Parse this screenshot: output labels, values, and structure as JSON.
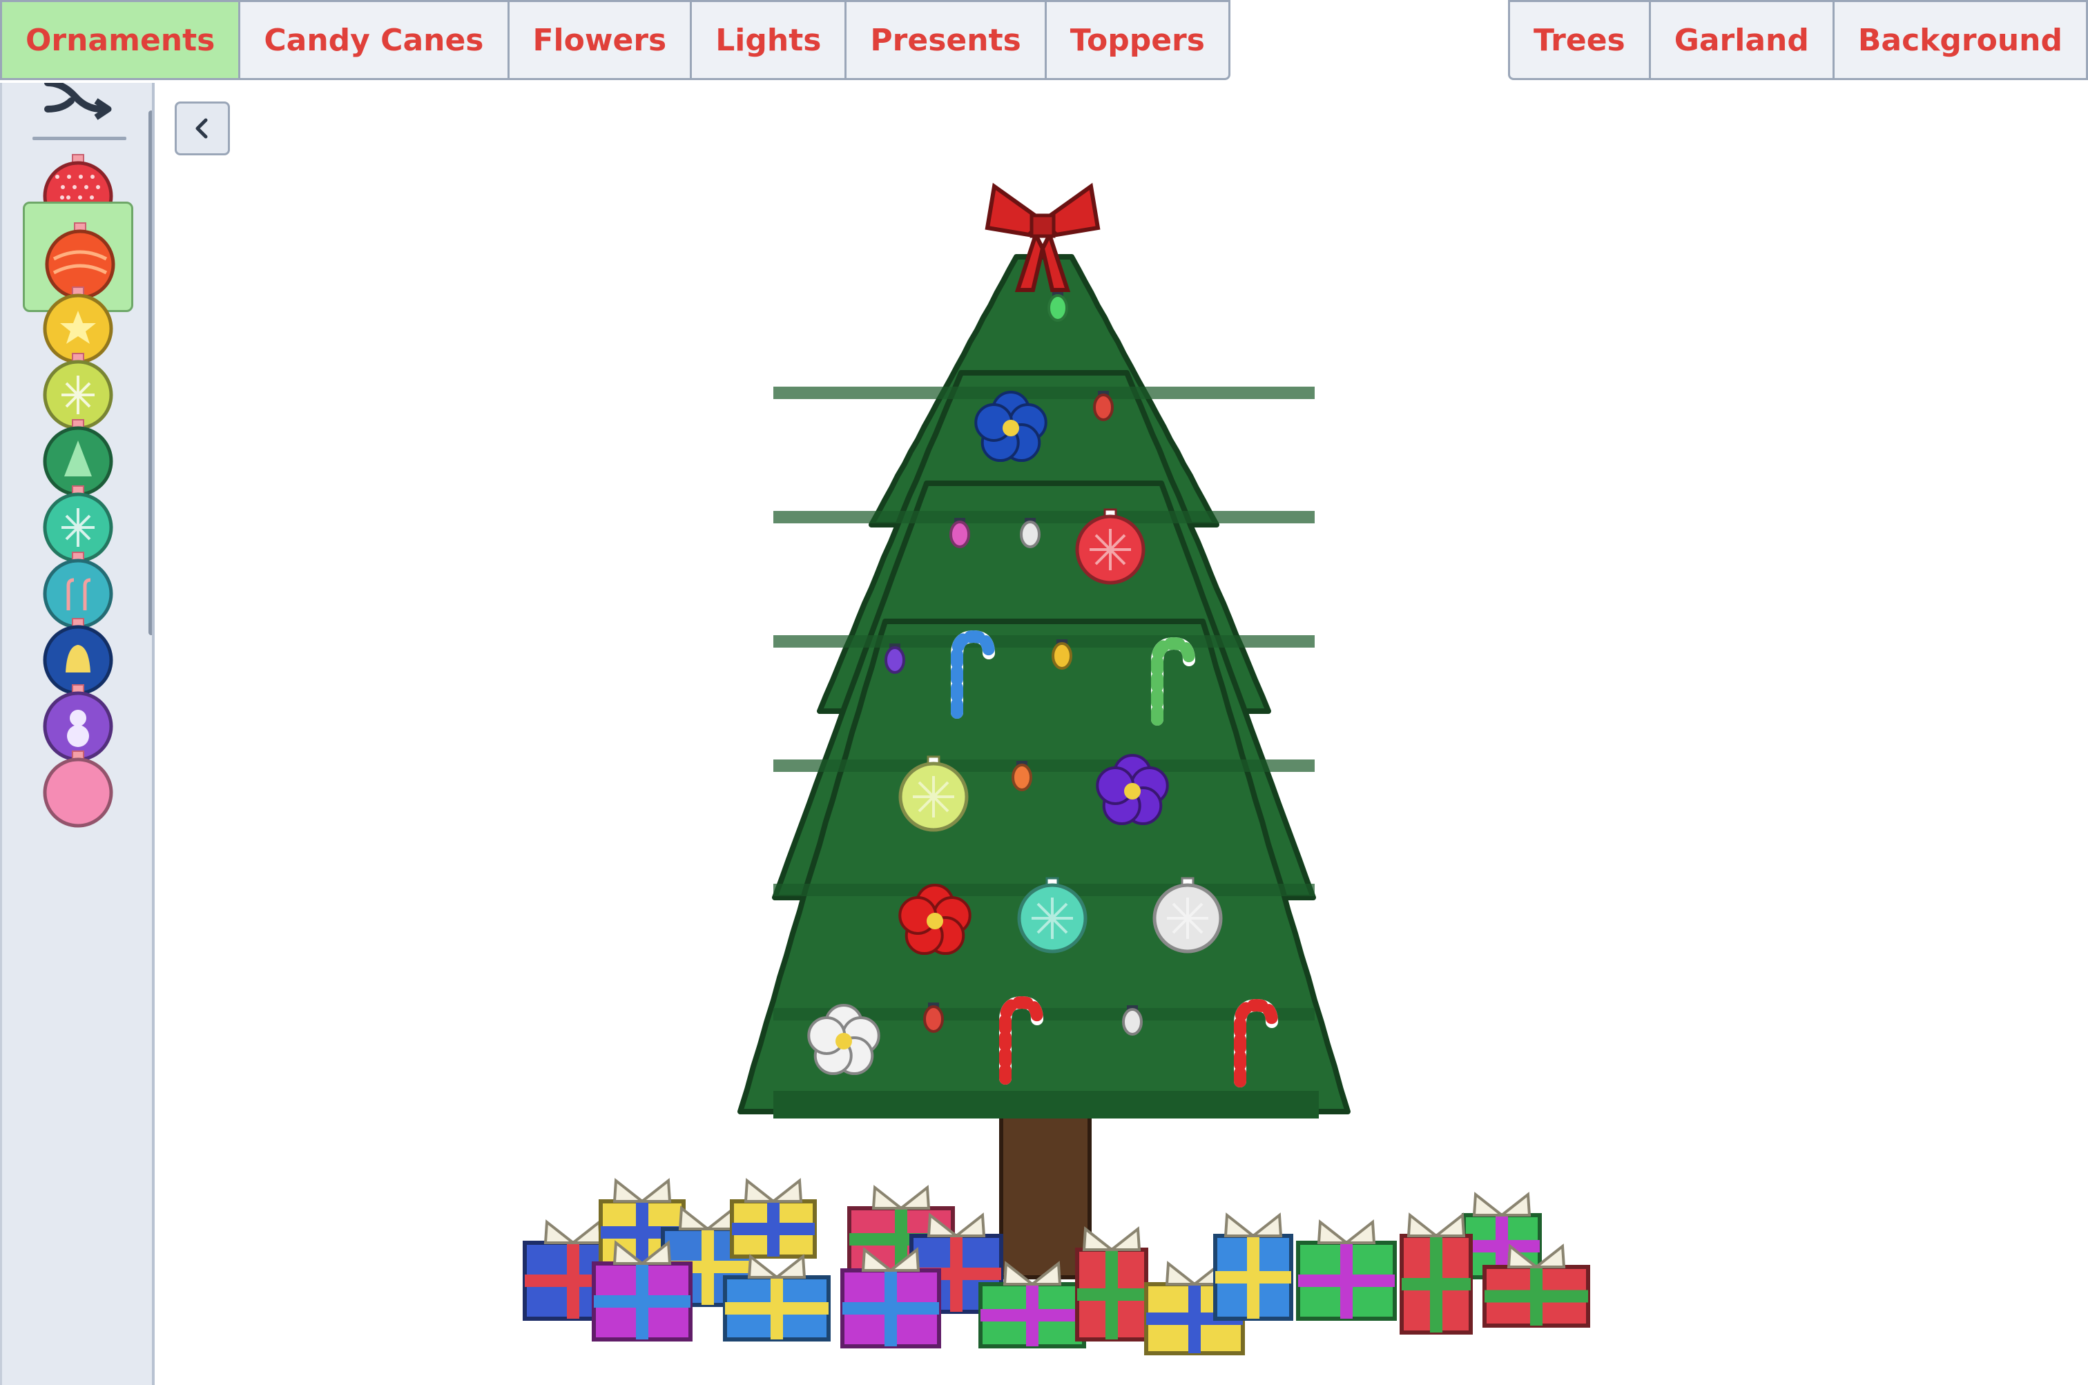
{
  "tabs_left": [
    {
      "label": "Ornaments",
      "active": true
    },
    {
      "label": "Candy Canes",
      "active": false
    },
    {
      "label": "Flowers",
      "active": false
    },
    {
      "label": "Lights",
      "active": false
    },
    {
      "label": "Presents",
      "active": false
    },
    {
      "label": "Toppers",
      "active": false
    }
  ],
  "tabs_right": [
    {
      "label": "Trees"
    },
    {
      "label": "Garland"
    },
    {
      "label": "Background"
    }
  ],
  "sidebar": {
    "top_icon": "shuffle-icon",
    "items": [
      {
        "name": "red-dotted-ornament",
        "color": "#e83a44",
        "pattern": "dots",
        "selected": false
      },
      {
        "name": "orange-swirl-ornament",
        "color": "#f2552a",
        "pattern": "swirl",
        "selected": true
      },
      {
        "name": "yellow-star-ornament",
        "color": "#f3c631",
        "pattern": "star",
        "selected": false
      },
      {
        "name": "lime-snowflake-ornament",
        "color": "#c9dd55",
        "pattern": "snowflake",
        "selected": false
      },
      {
        "name": "green-tree-ornament",
        "color": "#2e9a5e",
        "pattern": "tree",
        "selected": false
      },
      {
        "name": "teal-snowflake-ornament",
        "color": "#3cc6a0",
        "pattern": "snowflake",
        "selected": false
      },
      {
        "name": "cyan-candycane-ornament",
        "color": "#3cb4c2",
        "pattern": "canes",
        "selected": false
      },
      {
        "name": "blue-bell-ornament",
        "color": "#1f4fa8",
        "pattern": "bell",
        "selected": false
      },
      {
        "name": "purple-snowman-ornament",
        "color": "#8a4fd0",
        "pattern": "snowman",
        "selected": false
      },
      {
        "name": "pink-ornament",
        "color": "#f58cb4",
        "pattern": "plain",
        "selected": false
      }
    ]
  },
  "collapse_button": {
    "icon": "chevron-left-icon"
  },
  "scene": {
    "tree_color": "#236b32",
    "tree_shade": "#1b5a29",
    "trunk_color": "#5a3a22",
    "topper": {
      "type": "red-bow",
      "color": "#d62424"
    },
    "decorations": [
      {
        "kind": "light",
        "color": "#4fd66a"
      },
      {
        "kind": "flower",
        "color": "#1e4fc0"
      },
      {
        "kind": "light",
        "color": "#e0483c"
      },
      {
        "kind": "light",
        "color": "#e05cc0"
      },
      {
        "kind": "light",
        "color": "#e8e8e8"
      },
      {
        "kind": "ornament",
        "color": "#e83a44"
      },
      {
        "kind": "light",
        "color": "#7a44d8"
      },
      {
        "kind": "candycane",
        "color": "#3a8ae0"
      },
      {
        "kind": "light",
        "color": "#f0c030"
      },
      {
        "kind": "candycane",
        "color": "#5cc060"
      },
      {
        "kind": "ornament",
        "color": "#d8ea7a"
      },
      {
        "kind": "light",
        "color": "#f07a3a"
      },
      {
        "kind": "flower",
        "color": "#6a2ad0"
      },
      {
        "kind": "flower",
        "color": "#e02020"
      },
      {
        "kind": "ornament",
        "color": "#56d6b8"
      },
      {
        "kind": "ornament",
        "color": "#e6e6e6"
      },
      {
        "kind": "flower",
        "color": "#f2f2f2"
      },
      {
        "kind": "light",
        "color": "#e0483c"
      },
      {
        "kind": "candycane",
        "color": "#e02a2a"
      },
      {
        "kind": "light",
        "color": "#e8e8e8"
      },
      {
        "kind": "candycane",
        "color": "#e02a2a"
      }
    ],
    "presents": [
      {
        "box": "#3a5ad0",
        "ribbon": "#e0404a"
      },
      {
        "box": "#f0d84a",
        "ribbon": "#3a5ad0"
      },
      {
        "box": "#3a7ad8",
        "ribbon": "#f0d84a"
      },
      {
        "box": "#f0d84a",
        "ribbon": "#3a5ad0"
      },
      {
        "box": "#e0406a",
        "ribbon": "#3aa84a"
      },
      {
        "box": "#3a5ad0",
        "ribbon": "#e0404a"
      },
      {
        "box": "#c03ad0",
        "ribbon": "#3a8ae0"
      },
      {
        "box": "#3a8ae0",
        "ribbon": "#f0d84a"
      },
      {
        "box": "#c03ad0",
        "ribbon": "#3a8ae0"
      },
      {
        "box": "#3ac05a",
        "ribbon": "#c03ad0"
      },
      {
        "box": "#e0404a",
        "ribbon": "#3aa84a"
      },
      {
        "box": "#f0d84a",
        "ribbon": "#3a5ad0"
      },
      {
        "box": "#3a8ae0",
        "ribbon": "#f0d84a"
      },
      {
        "box": "#3ac05a",
        "ribbon": "#c03ad0"
      },
      {
        "box": "#3ac05a",
        "ribbon": "#c03ad0"
      },
      {
        "box": "#e0404a",
        "ribbon": "#3aa84a"
      },
      {
        "box": "#e0404a",
        "ribbon": "#3aa84a"
      }
    ]
  }
}
